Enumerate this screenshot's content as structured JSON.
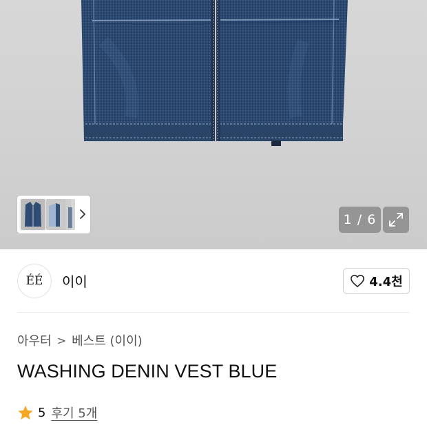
{
  "gallery": {
    "counter": "1 / 6",
    "thumbnails": [
      "vest-front",
      "vest-side",
      "vest-detail"
    ]
  },
  "brand": {
    "logo_text": "ÉÉ",
    "name": "이이",
    "likes": "4.4천"
  },
  "breadcrumb": {
    "category": "아우터",
    "separator": ">",
    "subcategory": "베스트 (이이)"
  },
  "product": {
    "title": "WASHING DENIN VEST BLUE"
  },
  "rating": {
    "score": "5",
    "reviews_label": "후기 5개"
  },
  "colors": {
    "star": "#f5a623",
    "denim": "#2e4a6e",
    "overlay": "#808080"
  }
}
